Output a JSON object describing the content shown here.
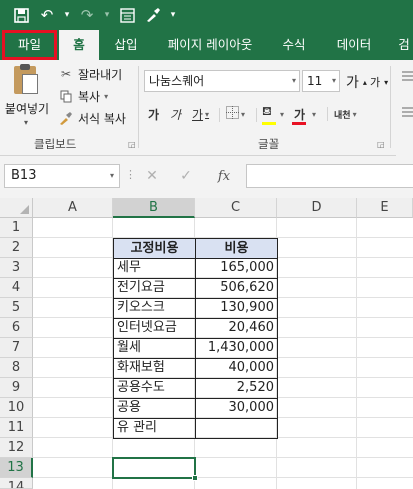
{
  "quick_access": {
    "icons": [
      "save-icon",
      "undo-icon",
      "undo-dropdown-icon",
      "redo-icon",
      "redo-dropdown-icon",
      "form-icon",
      "format-painter-icon",
      "customize-icon"
    ]
  },
  "tabs": [
    "파일",
    "홈",
    "삽입",
    "페이지 레이아웃",
    "수식",
    "데이터",
    "검"
  ],
  "ribbon": {
    "clipboard": {
      "paste_label": "붙여넣기",
      "cut_label": "잘라내기",
      "copy_label": "복사",
      "format_painter_label": "서식 복사",
      "group_label": "클립보드"
    },
    "font": {
      "font_name": "나눔스퀘어",
      "font_size": "11",
      "grow_label": "가",
      "shrink_label": "가",
      "bold_label": "가",
      "italic_label": "가",
      "underline_label": "가",
      "color_label": "가",
      "phonetic_label": "내천",
      "group_label": "글꼴"
    }
  },
  "formula_bar": {
    "name_box": "B13",
    "fx_label": "fx",
    "value": ""
  },
  "grid": {
    "columns": [
      "A",
      "B",
      "C",
      "D",
      "E"
    ],
    "selected_column": "B",
    "rows": [
      "1",
      "2",
      "3",
      "4",
      "5",
      "6",
      "7",
      "8",
      "9",
      "10",
      "11",
      "12",
      "13",
      "14"
    ],
    "selected_row": "13",
    "selected_cell": "B13"
  },
  "table": {
    "headers": [
      "고정비용",
      "비용"
    ],
    "rows": [
      [
        "세무",
        "165,000"
      ],
      [
        "전기요금",
        "506,620"
      ],
      [
        "키오스크",
        "130,900"
      ],
      [
        "인터넷요금",
        "20,460"
      ],
      [
        "월세",
        "1,430,000"
      ],
      [
        "화재보험",
        "40,000"
      ],
      [
        "공용수도",
        "2,520"
      ],
      [
        "공용",
        "30,000"
      ],
      [
        "유 관리",
        ""
      ]
    ]
  },
  "colors": {
    "excel_green": "#217346",
    "file_highlight": "#e81123",
    "header_fill": "#d9e1f2"
  }
}
